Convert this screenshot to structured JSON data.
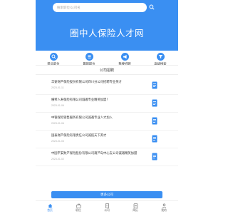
{
  "search": {
    "placeholder": "搜索职位/公司名"
  },
  "hero": {
    "title": "圈中人保险人才网"
  },
  "nav": {
    "items": [
      {
        "label": "猎头职位",
        "icon": "search-icon"
      },
      {
        "label": "最新职位",
        "icon": "list-icon"
      },
      {
        "label": "我要招聘",
        "icon": "megaphone-icon"
      },
      {
        "label": "高级搜索",
        "icon": "filter-icon"
      }
    ]
  },
  "section": {
    "title": "公司招聘"
  },
  "jobs": [
    {
      "title": "华安财产保险股份有限公司四川分公司招聘专业英才",
      "date": "2023-01-11"
    },
    {
      "title": "横琴人寿保险有限公司诚邀专业精英加盟！",
      "date": "2023-01-06"
    },
    {
      "title": "中银保险销售服务有限公司诚邀专业人才加入",
      "date": "2023-01-06"
    },
    {
      "title": "国泰财产保险有限责任公司诚揽天下英才",
      "date": "2023-01-03"
    },
    {
      "title": "中国平安财产保险股份有限公司葫芦岛中心支公司诚邀精英加盟",
      "date": "2023-01-02"
    }
  ],
  "more_button": {
    "label": "更多公司"
  },
  "tabbar": {
    "items": [
      {
        "label": "首页",
        "icon": "home-icon",
        "active": true
      },
      {
        "label": "职位",
        "icon": "briefcase-icon",
        "active": false
      },
      {
        "label": "公司",
        "icon": "building-icon",
        "active": false
      },
      {
        "label": "简历",
        "icon": "resume-icon",
        "active": false
      },
      {
        "label": "我的",
        "icon": "user-icon",
        "active": false
      }
    ]
  },
  "colors": {
    "accent": "#3a8ff2"
  }
}
